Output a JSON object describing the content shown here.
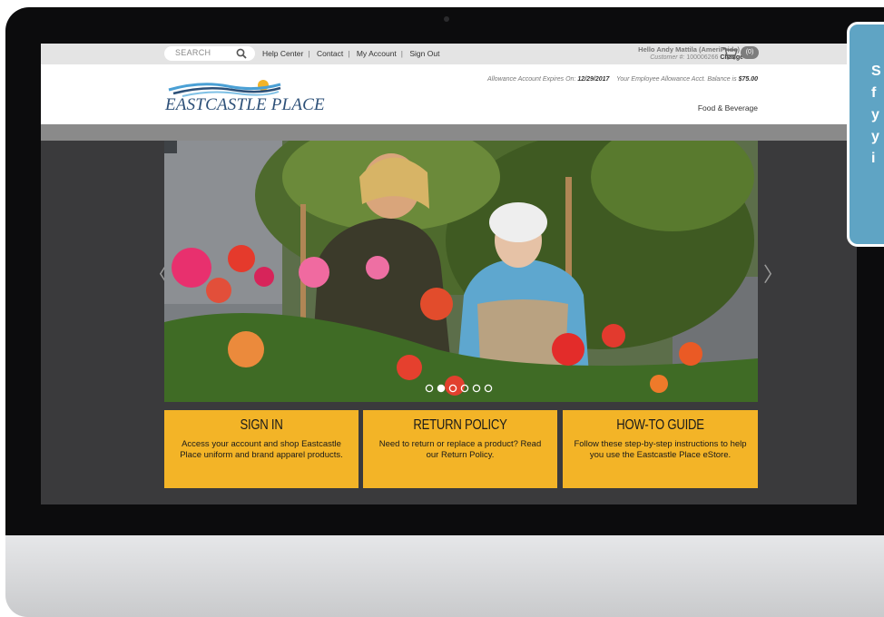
{
  "topbar": {
    "search_placeholder": "SEARCH",
    "links": [
      "Help Center",
      "Contact",
      "My Account",
      "Sign Out"
    ],
    "greeting": "Hello Andy Mattila (AmeriPride)",
    "customer_label": "Customer #:",
    "customer_number": "100006266",
    "change_label": "Change",
    "cart_count": "(0)"
  },
  "header": {
    "allowance_expiry_label": "Allowance Account Expires On:",
    "allowance_expiry_date": "12/29/2017",
    "allowance_balance_label": "Your Employee Allowance Acct. Balance is",
    "allowance_balance": "$75.00",
    "logo_text": "EASTCASTLE PLACE",
    "nav_item": "Food & Beverage"
  },
  "carousel": {
    "prev_arrow": "〈",
    "next_arrow": "〉",
    "active_slide": 2,
    "slide_count": 6
  },
  "cards": [
    {
      "title": "SIGN IN",
      "text": "Access your account and shop Eastcastle Place uniform and brand apparel products."
    },
    {
      "title": "RETURN POLICY",
      "text": "Need to return or replace a product? Read our Return Policy."
    },
    {
      "title": "HOW-TO GUIDE",
      "text": "Follow these step-by-step instructions to help you use the Eastcastle Place eStore."
    }
  ],
  "callout": {
    "lines": [
      "S",
      "f",
      "y",
      "y",
      "i"
    ]
  },
  "colors": {
    "accent_orange": "#f3b427",
    "logo_blue": "#2d5078",
    "callout_blue": "#5fa4c4"
  }
}
